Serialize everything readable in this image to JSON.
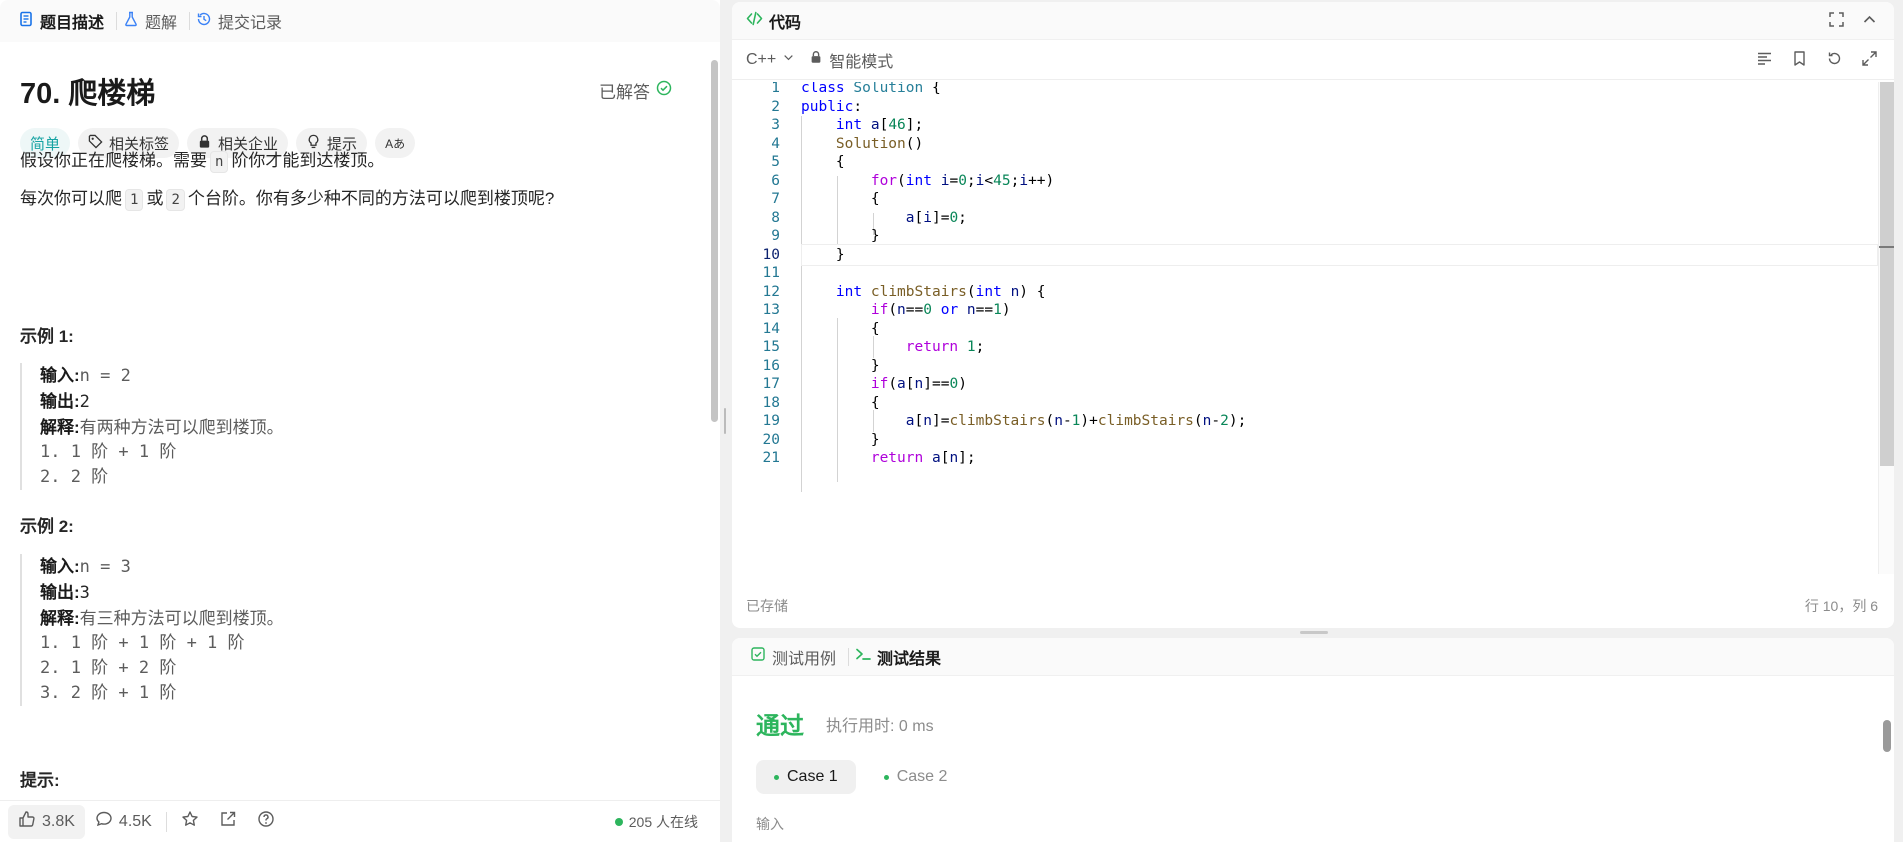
{
  "left_tabs": [
    {
      "label": "题目描述",
      "icon": "document-icon",
      "active": true
    },
    {
      "label": "题解",
      "icon": "flask-icon",
      "active": false
    },
    {
      "label": "提交记录",
      "icon": "history-icon",
      "active": false
    }
  ],
  "problem": {
    "title": "70. 爬楼梯",
    "status": "已解答",
    "tags": [
      "简单",
      "相关标签",
      "相关企业",
      "提示",
      "Aあ"
    ],
    "desc1_before": "假设你正在爬楼梯。需要",
    "desc1_code": "n",
    "desc1_after": "阶你才能到达楼顶。",
    "desc2_a": "每次你可以爬",
    "desc2_code1": "1",
    "desc2_b": "或",
    "desc2_code2": "2",
    "desc2_c": "个台阶。你有多少种不同的方法可以爬到楼顶呢?",
    "example1": {
      "title": "示例 1:",
      "input_label": "输入:",
      "input": "n = 2",
      "output_label": "输出:",
      "output": "2",
      "explain_label": "解释:",
      "explain": "有两种方法可以爬到楼顶。",
      "steps": [
        "1. 1 阶 + 1 阶",
        "2. 2 阶"
      ]
    },
    "example2": {
      "title": "示例 2:",
      "input_label": "输入:",
      "input": "n = 3",
      "output_label": "输出:",
      "output": "3",
      "explain_label": "解释:",
      "explain": "有三种方法可以爬到楼顶。",
      "steps": [
        "1. 1 阶 + 1 阶 + 1 阶",
        "2. 1 阶 + 2 阶",
        "3. 2 阶 + 1 阶"
      ]
    },
    "hint_title": "提示:"
  },
  "footer": {
    "likes": "3.8K",
    "comments": "4.5K",
    "online": "205 人在线"
  },
  "code_panel": {
    "title": "代码",
    "language": "C++",
    "mode": "智能模式",
    "saved": "已存储",
    "cursor_pos": "行 10，列 6",
    "current_line": 10,
    "line_numbers": [
      "1",
      "2",
      "3",
      "4",
      "5",
      "6",
      "7",
      "8",
      "9",
      "10",
      "11",
      "12",
      "13",
      "14",
      "15",
      "16",
      "17",
      "18",
      "19",
      "20",
      "21"
    ]
  },
  "test_panel": {
    "tabs": [
      "测试用例",
      "测试结果"
    ],
    "result": "通过",
    "runtime": "执行用时: 0 ms",
    "cases": [
      "Case 1",
      "Case 2"
    ],
    "input_label": "输入"
  }
}
